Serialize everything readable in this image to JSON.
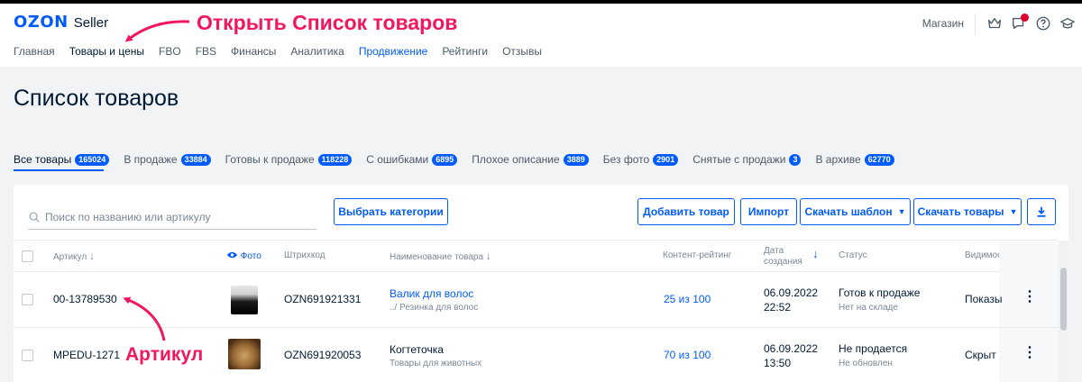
{
  "header": {
    "logo_brand": "OZON",
    "logo_suffix": "Seller",
    "nav": [
      "Главная",
      "Товары и цены",
      "FBO",
      "FBS",
      "Финансы",
      "Аналитика",
      "Продвижение",
      "Рейтинги",
      "Отзывы"
    ],
    "shop_label": "Магазин"
  },
  "annotations": {
    "top": "Открыть Список товаров",
    "article": "Артикул"
  },
  "page": {
    "title": "Список товаров"
  },
  "tabs": [
    {
      "label": "Все товары",
      "count": "165024"
    },
    {
      "label": "В продаже",
      "count": "33884"
    },
    {
      "label": "Готовы к продаже",
      "count": "118228"
    },
    {
      "label": "С ошибками",
      "count": "6895"
    },
    {
      "label": "Плохое описание",
      "count": "3889"
    },
    {
      "label": "Без фото",
      "count": "2901"
    },
    {
      "label": "Снятые с продажи",
      "count": "3"
    },
    {
      "label": "В архиве",
      "count": "62770"
    }
  ],
  "toolbar": {
    "search_placeholder": "Поиск по названию или артикулу",
    "choose_categories": "Выбрать категории",
    "add_product": "Добавить товар",
    "import": "Импорт",
    "download_template": "Скачать шаблон",
    "download_products": "Скачать товары"
  },
  "table": {
    "headers": {
      "article": "Артикул",
      "photo": "Фото",
      "barcode": "Штрихкод",
      "name": "Наименование товара",
      "content_rating": "Контент-рейтинг",
      "date_line1": "Дата",
      "date_line2": "создания",
      "status": "Статус",
      "visibility": "Видимос"
    },
    "rows": [
      {
        "article": "00-13789530",
        "barcode": "OZN691921331",
        "name": "Валик для волос",
        "category": "../ Резинка для волос",
        "rating": "25 из 100",
        "date": "06.09.2022",
        "time": "22:52",
        "status": "Готов к продаже",
        "status_sub": "Нет на складе",
        "visibility": "Показы"
      },
      {
        "article": "MPEDU-1271",
        "barcode": "OZN691920053",
        "name": "Когтеточка",
        "category": "Товары для животных",
        "rating": "70 из 100",
        "date": "06.09.2022",
        "time": "13:50",
        "status": "Не продается",
        "status_sub": "Не обновлен",
        "visibility": "Скрыт"
      }
    ]
  },
  "colors": {
    "brand": "#005bff",
    "annotation": "#f1175f",
    "notification": "#e0002f"
  }
}
